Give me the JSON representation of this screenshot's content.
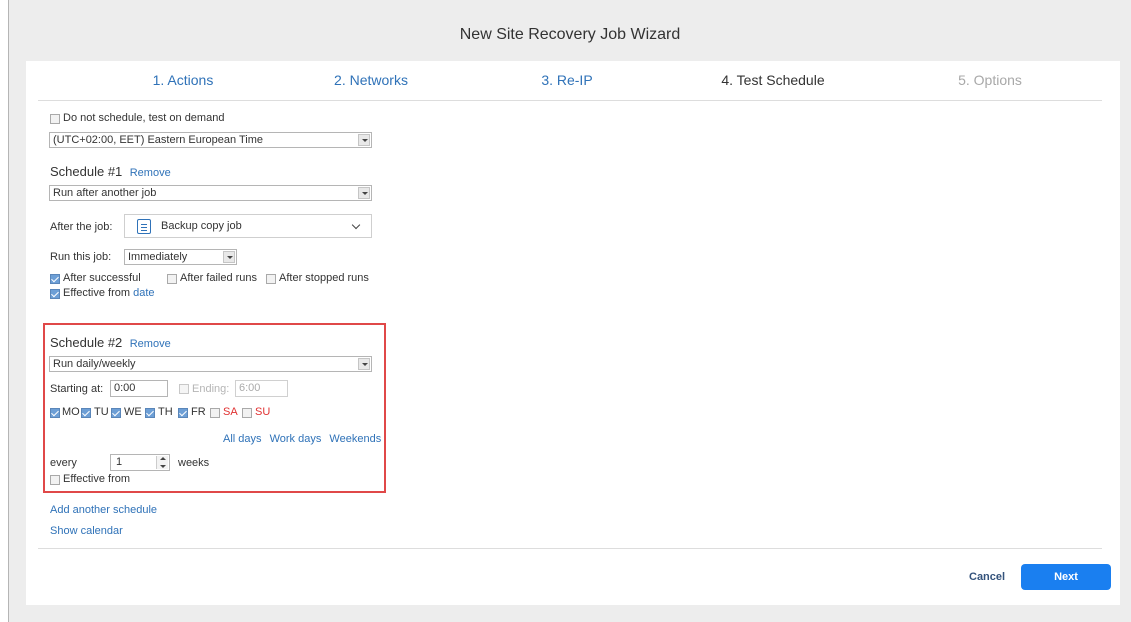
{
  "window": {
    "title": "New Site Recovery Job Wizard"
  },
  "steps": [
    {
      "label": "1. Actions",
      "state": "link"
    },
    {
      "label": "2. Networks",
      "state": "link"
    },
    {
      "label": "3. Re-IP",
      "state": "link"
    },
    {
      "label": "4. Test Schedule",
      "state": "current"
    },
    {
      "label": "5. Options",
      "state": "disabled"
    }
  ],
  "general": {
    "no_schedule_label": "Do not schedule, test on demand",
    "no_schedule_checked": false,
    "timezone_value": "(UTC+02:00, EET) Eastern European Time"
  },
  "schedule1": {
    "title": "Schedule #1",
    "remove_label": "Remove",
    "type_value": "Run after another job",
    "after_job_label": "After the job:",
    "after_job_value": "Backup copy job",
    "run_this_job_label": "Run this job:",
    "run_this_job_value": "Immediately",
    "after_successful_label": "After successful",
    "after_successful_checked": true,
    "after_failed_label": "After failed runs",
    "after_failed_checked": false,
    "after_stopped_label": "After stopped runs",
    "after_stopped_checked": false,
    "effective_from_label": "Effective from",
    "effective_from_checked": true,
    "date_link": "date"
  },
  "schedule2": {
    "title": "Schedule #2",
    "remove_label": "Remove",
    "type_value": "Run daily/weekly",
    "starting_at_label": "Starting at:",
    "starting_at_value": "0:00",
    "ending_label": "Ending:",
    "ending_value": "6:00",
    "ending_checked": false,
    "days": [
      {
        "label": "MO",
        "checked": true,
        "weekend": false
      },
      {
        "label": "TU",
        "checked": true,
        "weekend": false
      },
      {
        "label": "WE",
        "checked": true,
        "weekend": false
      },
      {
        "label": "TH",
        "checked": true,
        "weekend": false
      },
      {
        "label": "FR",
        "checked": true,
        "weekend": false
      },
      {
        "label": "SA",
        "checked": false,
        "weekend": true
      },
      {
        "label": "SU",
        "checked": false,
        "weekend": true
      }
    ],
    "all_days_label": "All days",
    "work_days_label": "Work days",
    "weekends_label": "Weekends",
    "every_label": "every",
    "every_value": "1",
    "weeks_label": "weeks",
    "effective_from_label": "Effective from",
    "effective_from_checked": false
  },
  "links": {
    "add_schedule": "Add another schedule",
    "show_calendar": "Show calendar"
  },
  "footer": {
    "cancel_label": "Cancel",
    "next_label": "Next"
  },
  "colors": {
    "accent": "#1a7ff0",
    "link": "#2f72b8",
    "highlight_border": "#e04848",
    "weekend_text": "#e03030"
  }
}
